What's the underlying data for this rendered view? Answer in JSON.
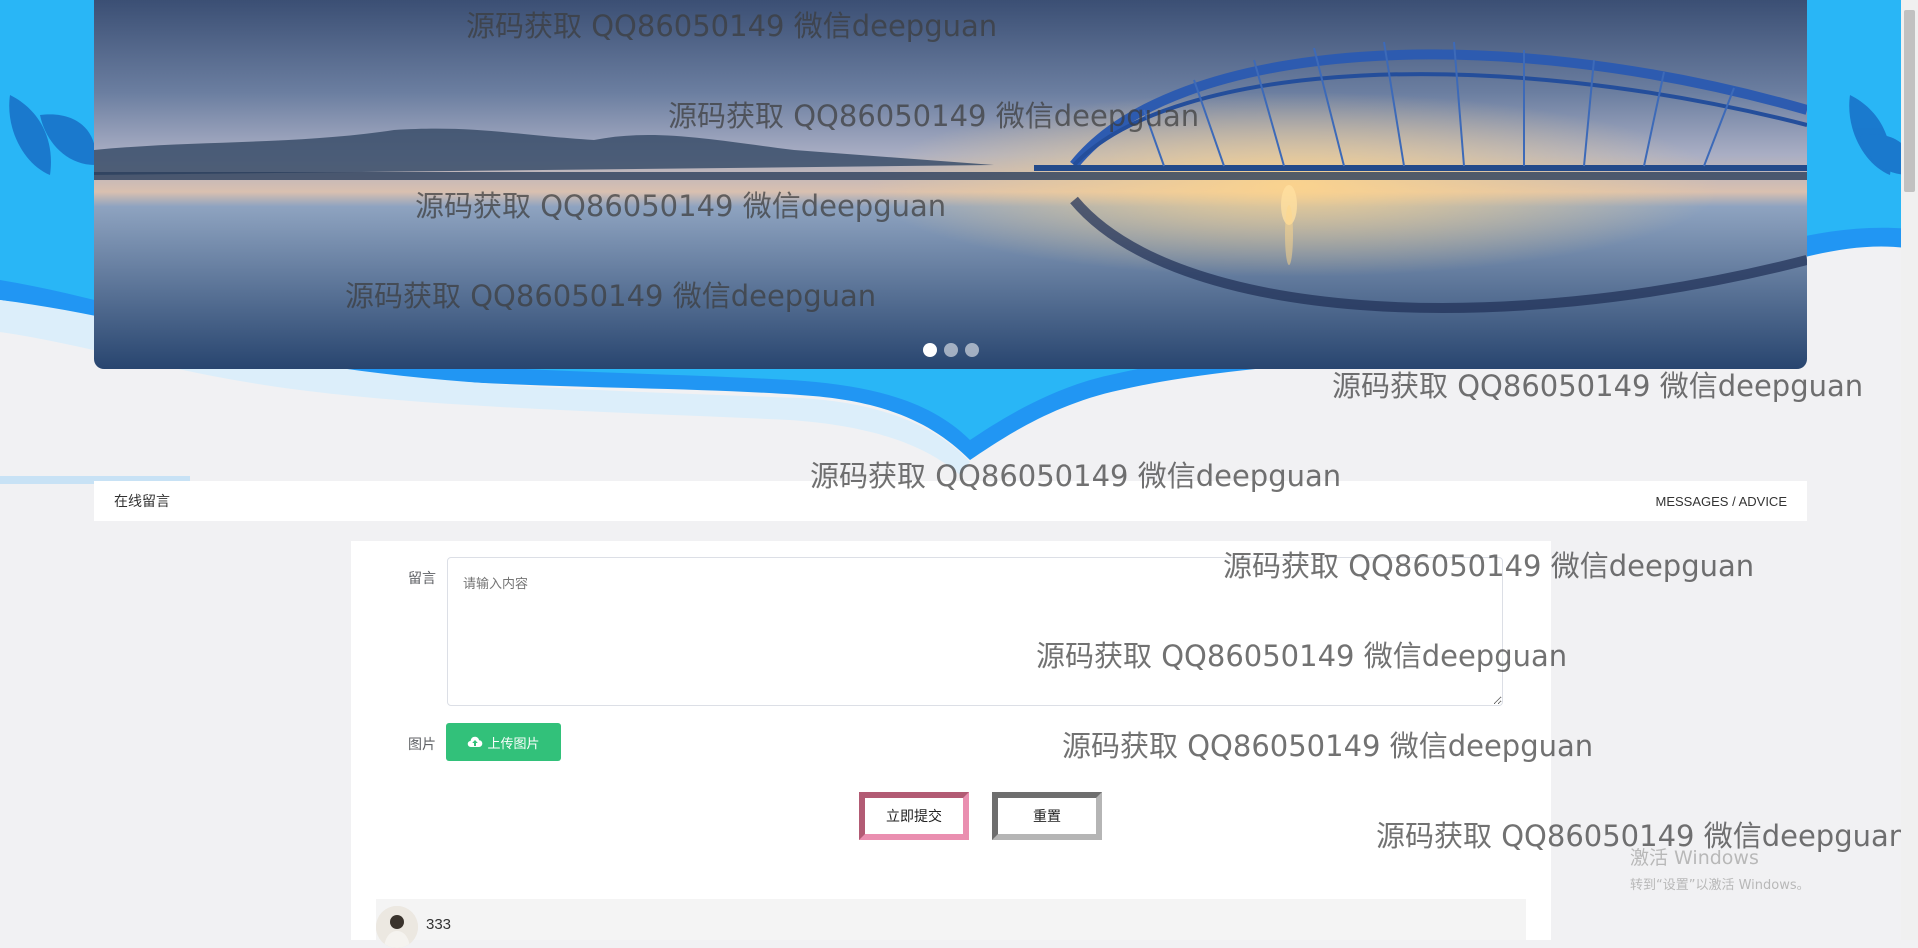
{
  "banner": {
    "slide_count": 3,
    "active_slide": 1
  },
  "section": {
    "title": "在线留言",
    "subtitle": "MESSAGES / ADVICE"
  },
  "form": {
    "message_label": "留言",
    "message_placeholder": "请输入内容",
    "image_label": "图片",
    "upload_label": "上传图片",
    "submit_label": "立即提交",
    "reset_label": "重置"
  },
  "comments": [
    {
      "name": "333"
    }
  ],
  "watermark_text": "源码获取 QQ86050149 微信deepguan",
  "os_notice": {
    "title": "激活 Windows",
    "subtitle": "转到“设置”以激活 Windows。"
  }
}
